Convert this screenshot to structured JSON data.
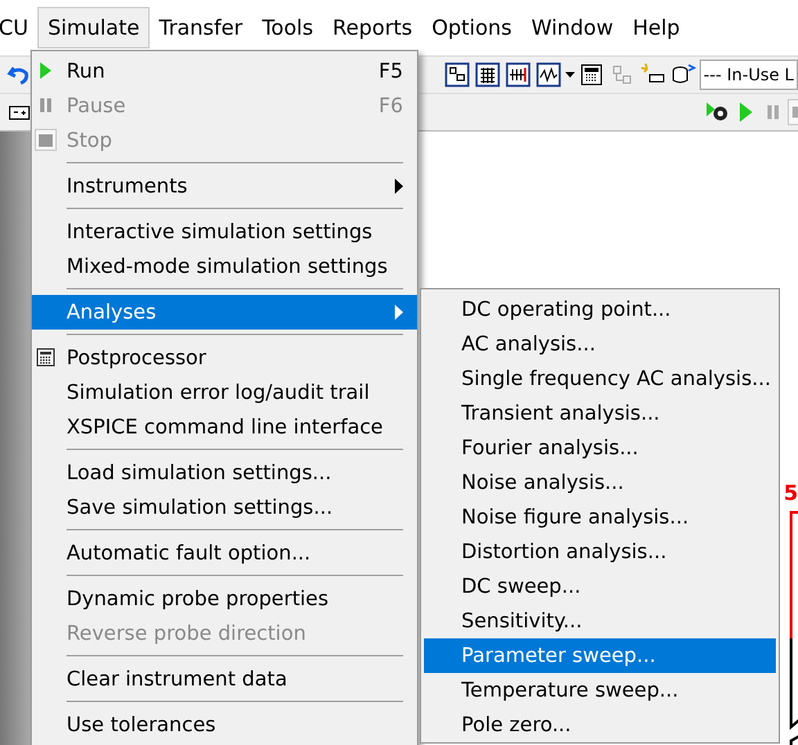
{
  "menubar": [
    {
      "label": "CU",
      "selected": false
    },
    {
      "label": "Simulate",
      "selected": true
    },
    {
      "label": "Transfer",
      "selected": false
    },
    {
      "label": "Tools",
      "selected": false
    },
    {
      "label": "Reports",
      "selected": false
    },
    {
      "label": "Options",
      "selected": false
    },
    {
      "label": "Window",
      "selected": false
    },
    {
      "label": "Help",
      "selected": false
    }
  ],
  "toolbar": {
    "in_use_list": "--- In-Use L"
  },
  "canvas": {
    "net_label": "5"
  },
  "menu": [
    {
      "kind": "item",
      "label": "Run",
      "shortcut": "F5",
      "disabled": false,
      "selected": false
    },
    {
      "kind": "item",
      "label": "Pause",
      "shortcut": "F6",
      "disabled": true,
      "selected": false
    },
    {
      "kind": "item",
      "label": "Stop",
      "disabled": true,
      "selected": false
    },
    {
      "kind": "separator"
    },
    {
      "kind": "item",
      "label": "Instruments",
      "submenu": true,
      "disabled": false,
      "selected": false
    },
    {
      "kind": "separator"
    },
    {
      "kind": "item",
      "label": "Interactive simulation settings",
      "disabled": false,
      "selected": false
    },
    {
      "kind": "item",
      "label": "Mixed-mode simulation settings",
      "disabled": false,
      "selected": false
    },
    {
      "kind": "separator"
    },
    {
      "kind": "item",
      "label": "Analyses",
      "submenu": true,
      "disabled": false,
      "selected": true
    },
    {
      "kind": "separator"
    },
    {
      "kind": "item",
      "label": "Postprocessor",
      "disabled": false,
      "selected": false
    },
    {
      "kind": "item",
      "label": "Simulation error log/audit trail",
      "disabled": false,
      "selected": false
    },
    {
      "kind": "item",
      "label": "XSPICE command line interface",
      "disabled": false,
      "selected": false
    },
    {
      "kind": "separator"
    },
    {
      "kind": "item",
      "label": "Load simulation settings...",
      "disabled": false,
      "selected": false
    },
    {
      "kind": "item",
      "label": "Save simulation settings...",
      "disabled": false,
      "selected": false
    },
    {
      "kind": "separator"
    },
    {
      "kind": "item",
      "label": "Automatic fault option...",
      "disabled": false,
      "selected": false
    },
    {
      "kind": "separator"
    },
    {
      "kind": "item",
      "label": "Dynamic probe properties",
      "disabled": false,
      "selected": false
    },
    {
      "kind": "item",
      "label": "Reverse probe direction",
      "disabled": true,
      "selected": false
    },
    {
      "kind": "separator"
    },
    {
      "kind": "item",
      "label": "Clear instrument data",
      "disabled": false,
      "selected": false
    },
    {
      "kind": "separator"
    },
    {
      "kind": "item",
      "label": "Use tolerances",
      "disabled": false,
      "selected": false
    }
  ],
  "analyses_submenu": [
    {
      "label": "DC operating point...",
      "selected": false
    },
    {
      "label": "AC analysis...",
      "selected": false
    },
    {
      "label": "Single frequency AC analysis...",
      "selected": false
    },
    {
      "label": "Transient analysis...",
      "selected": false
    },
    {
      "label": "Fourier analysis...",
      "selected": false
    },
    {
      "label": "Noise analysis...",
      "selected": false
    },
    {
      "label": "Noise figure analysis...",
      "selected": false
    },
    {
      "label": "Distortion analysis...",
      "selected": false
    },
    {
      "label": "DC sweep...",
      "selected": false
    },
    {
      "label": "Sensitivity...",
      "selected": false
    },
    {
      "label": "Parameter sweep...",
      "selected": true
    },
    {
      "label": "Temperature sweep...",
      "selected": false
    },
    {
      "label": "Pole zero...",
      "selected": false
    }
  ]
}
